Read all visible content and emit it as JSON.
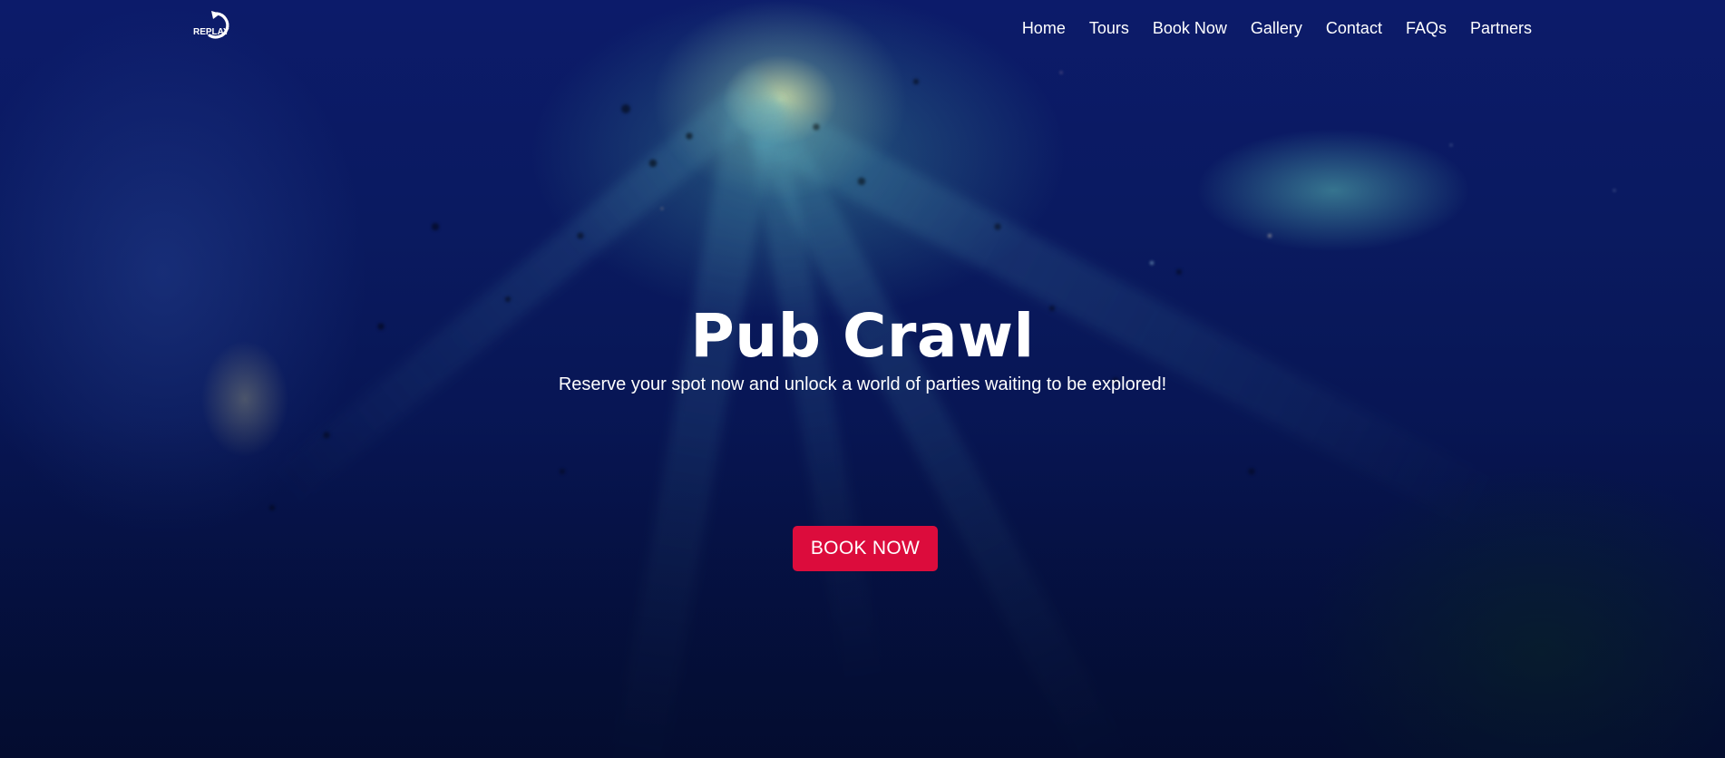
{
  "brand": {
    "logo_text": "REPLAY",
    "logo_icon": "replay-arrow-icon"
  },
  "nav": {
    "items": [
      {
        "label": "Home"
      },
      {
        "label": "Tours"
      },
      {
        "label": "Book Now"
      },
      {
        "label": "Gallery"
      },
      {
        "label": "Contact"
      },
      {
        "label": "FAQs"
      },
      {
        "label": "Partners"
      }
    ]
  },
  "hero": {
    "title": "Pub Crawl",
    "subtitle": "Reserve your spot now and unlock a world of parties waiting to be explored!",
    "cta_label": "BOOK NOW"
  },
  "colors": {
    "cta_background": "#dc0c3c",
    "text": "#ffffff",
    "background_dark": "#0a1a60"
  }
}
